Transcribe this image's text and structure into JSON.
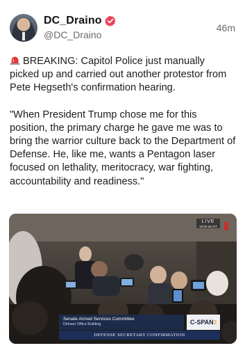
{
  "post": {
    "author": {
      "display_name": "DC_Draino",
      "handle": "@DC_Draino",
      "verified": true,
      "avatar_icon": "avatar-photo"
    },
    "timestamp": "46m",
    "paragraphs": [
      "BREAKING: Capitol Police just manually picked up and carried out another protestor from Pete Hegseth's confirmation hearing.",
      "\"When President Trump chose me for this position, the primary charge he gave me was to bring the warrior culture back to the Department of Defense. He, like me, wants a Pentagon laser focused on lethality, meritocracy, war fighting, accountability and readiness.\""
    ],
    "lead_icon": "siren-icon",
    "colors": {
      "verified_badge": "#e8445a",
      "siren": "#e23b3b",
      "secondary_text": "#6b6b6b"
    }
  },
  "media": {
    "live_badge": {
      "label": "LIVE",
      "time": "10:09 am ET"
    },
    "lower_third": {
      "line1": "Senate Armed Services Committee",
      "line2": "Dirksen Office Building"
    },
    "network": {
      "name": "C-SPAN",
      "number": "3"
    },
    "chyron": "DEFENSE SECRETARY CONFIRMATION"
  }
}
